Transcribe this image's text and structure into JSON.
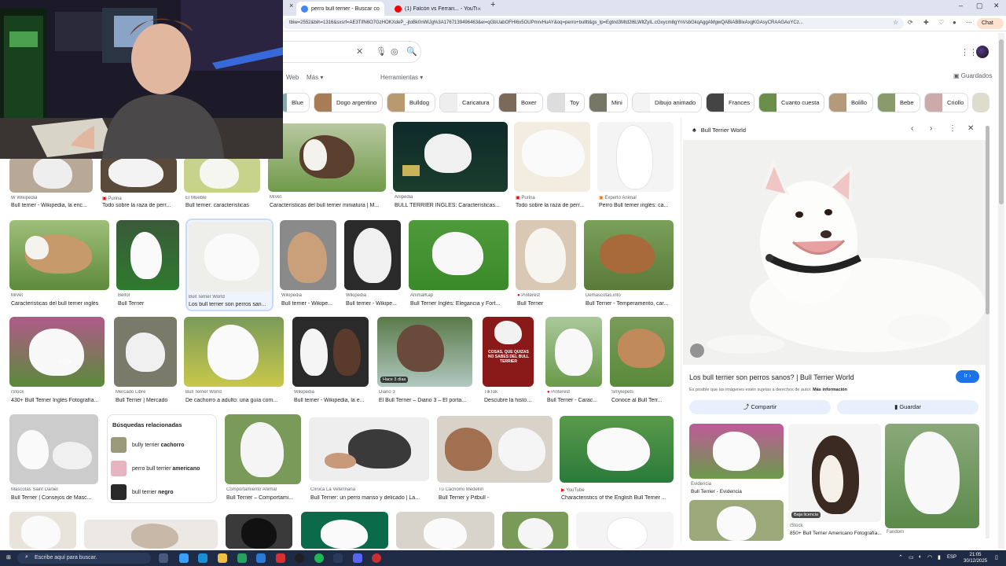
{
  "browser": {
    "tabs": [
      {
        "label": "perro bull terrier - Buscar con Goo",
        "active": true
      },
      {
        "label": "(1) Falcón vs Ferrari... - YouTube",
        "active": false
      }
    ],
    "url": "tbiw=2552&bih=1316&sxsrf=AE3TifN6O7GzHOKXdeP_-jtoBk0nWlJg%3A1767139496463&ei=qGbUabOFHI6x5OUPmrvHuAY&oq=perro+bulltt&gs_lp=Egtnd3Mtd2l6LWltZyIL.cGxycm8gYnVsbGkqAggAMgwQABiABBixAxgKGAsyCRAAGAoYCz...",
    "chat_label": "Chat"
  },
  "search": {
    "nav": [
      "Web",
      "Más",
      "Herramientas"
    ],
    "saved": "Guardados"
  },
  "chips": [
    {
      "label": "Blue"
    },
    {
      "label": "Dogo argentino"
    },
    {
      "label": "Bulldog"
    },
    {
      "label": "Caricatura"
    },
    {
      "label": "Boxer"
    },
    {
      "label": "Toy"
    },
    {
      "label": "Mini"
    },
    {
      "label": "Dibujo animado"
    },
    {
      "label": "Frances"
    },
    {
      "label": "Cuanto cuesta"
    },
    {
      "label": "Bolillo"
    },
    {
      "label": "Bebe"
    },
    {
      "label": "Criollo"
    }
  ],
  "results": [
    {
      "source": "Wikipedia",
      "title": "Bull terrier - Wikipedia, la enc..."
    },
    {
      "source": "Purina",
      "title": "Todo sobre la raza de perr..."
    },
    {
      "source": "El Mueble",
      "title": "Bull terrier: características"
    },
    {
      "source": "MiVet",
      "title": "Características del bull terrier miniatura | M..."
    },
    {
      "source": "Anipedia",
      "title": "BULL TERRIER INGLÉS: Características..."
    },
    {
      "source": "Purina",
      "title": "Todo sobre la raza de perr..."
    },
    {
      "source": "Experto Animal",
      "title": "Perro Bull terrier inglés: ca..."
    },
    {
      "source": "MiVet",
      "title": "Características del bull terrier inglés"
    },
    {
      "source": "Belfor",
      "title": "Bull Terrier"
    },
    {
      "source": "Bull Terrier World",
      "title": "Los bull terrier son perros san..."
    },
    {
      "source": "Wikipedia",
      "title": "Bull terrier - Wikipe..."
    },
    {
      "source": "Wikipedia",
      "title": "Bull terrier - Wikipe..."
    },
    {
      "source": "AnimalKap",
      "title": "Bull Terrier Inglés: Elegancia y Fort..."
    },
    {
      "source": "Pinterest",
      "title": "Bull Terrier"
    },
    {
      "source": "Demascotas.info",
      "title": "Bull Terrier - Temperamento, car..."
    },
    {
      "source": "iStock",
      "title": "430+ Bull Terrier Inglés Fotografía..."
    },
    {
      "source": "Mercado Libre",
      "title": "Bull Terrier | Mercado"
    },
    {
      "source": "Bull Terrier World",
      "title": "De cachorro a adulto: una guía com..."
    },
    {
      "source": "Wikipedia",
      "title": "Bull terrier - Wikipedia, la e..."
    },
    {
      "source": "Diario 3",
      "title": "El Bull Terrier – Diario 3 – El porta..."
    },
    {
      "source": "TikTok",
      "title": "Descubre la histori..."
    },
    {
      "source": "Pinterest",
      "title": "Bull Terrier - Carac..."
    },
    {
      "source": "Smylepets",
      "title": "Conoce al Bull Terr..."
    },
    {
      "source": "Mascotas Saint Daniel",
      "title": "Bull Terrier | Consejos de Masc..."
    },
    {
      "source": "Comportamiento Animal",
      "title": "Bull Terrier – Comportami..."
    },
    {
      "source": "Clínica La Veterinaria",
      "title": "Bull Terrier: un perro manso y delicado | La..."
    },
    {
      "source": "Tu Cachorro Medellín",
      "title": "Bull Terrier y Pitbull -"
    },
    {
      "source": "YouTube",
      "title": "Characteristics of the English Bull Terrier ..."
    }
  ],
  "overlays": {
    "istock_text": "iStock",
    "hace": "Hace 3 días",
    "tiktok_text": "COSAS, QUE QUIZAS NO SABES DEL BULL TERRIER"
  },
  "related": {
    "heading": "Búsquedas relacionadas",
    "items": [
      {
        "plain": "bully terrier ",
        "bold": "cachorro"
      },
      {
        "plain": "perro bull terrier ",
        "bold": "americano"
      },
      {
        "plain": "bull terrier ",
        "bold": "negro"
      }
    ]
  },
  "panel": {
    "source": "Bull Terrier World",
    "title": "Los bull terrier son perros sanos? | Bull Terrier World",
    "visit": "Ir",
    "note": "Es posible que las imágenes estén sujetas a derechos de autor.",
    "note_link": "Más información",
    "share": "Compartir",
    "save": "Guardar",
    "similar": [
      {
        "source": "Evidencia",
        "title": "Bull Terrier - Evidencia"
      },
      {
        "source": "iStock",
        "title": "850+ Bull Terrier Americano Fotografía..."
      },
      {
        "source": "Fandom",
        "title": ""
      }
    ],
    "badge": "Baja licencia"
  },
  "taskbar": {
    "search": "Escribe aquí para buscar.",
    "time": "21:05",
    "date": "30/12/2025",
    "lang": "ESP"
  }
}
